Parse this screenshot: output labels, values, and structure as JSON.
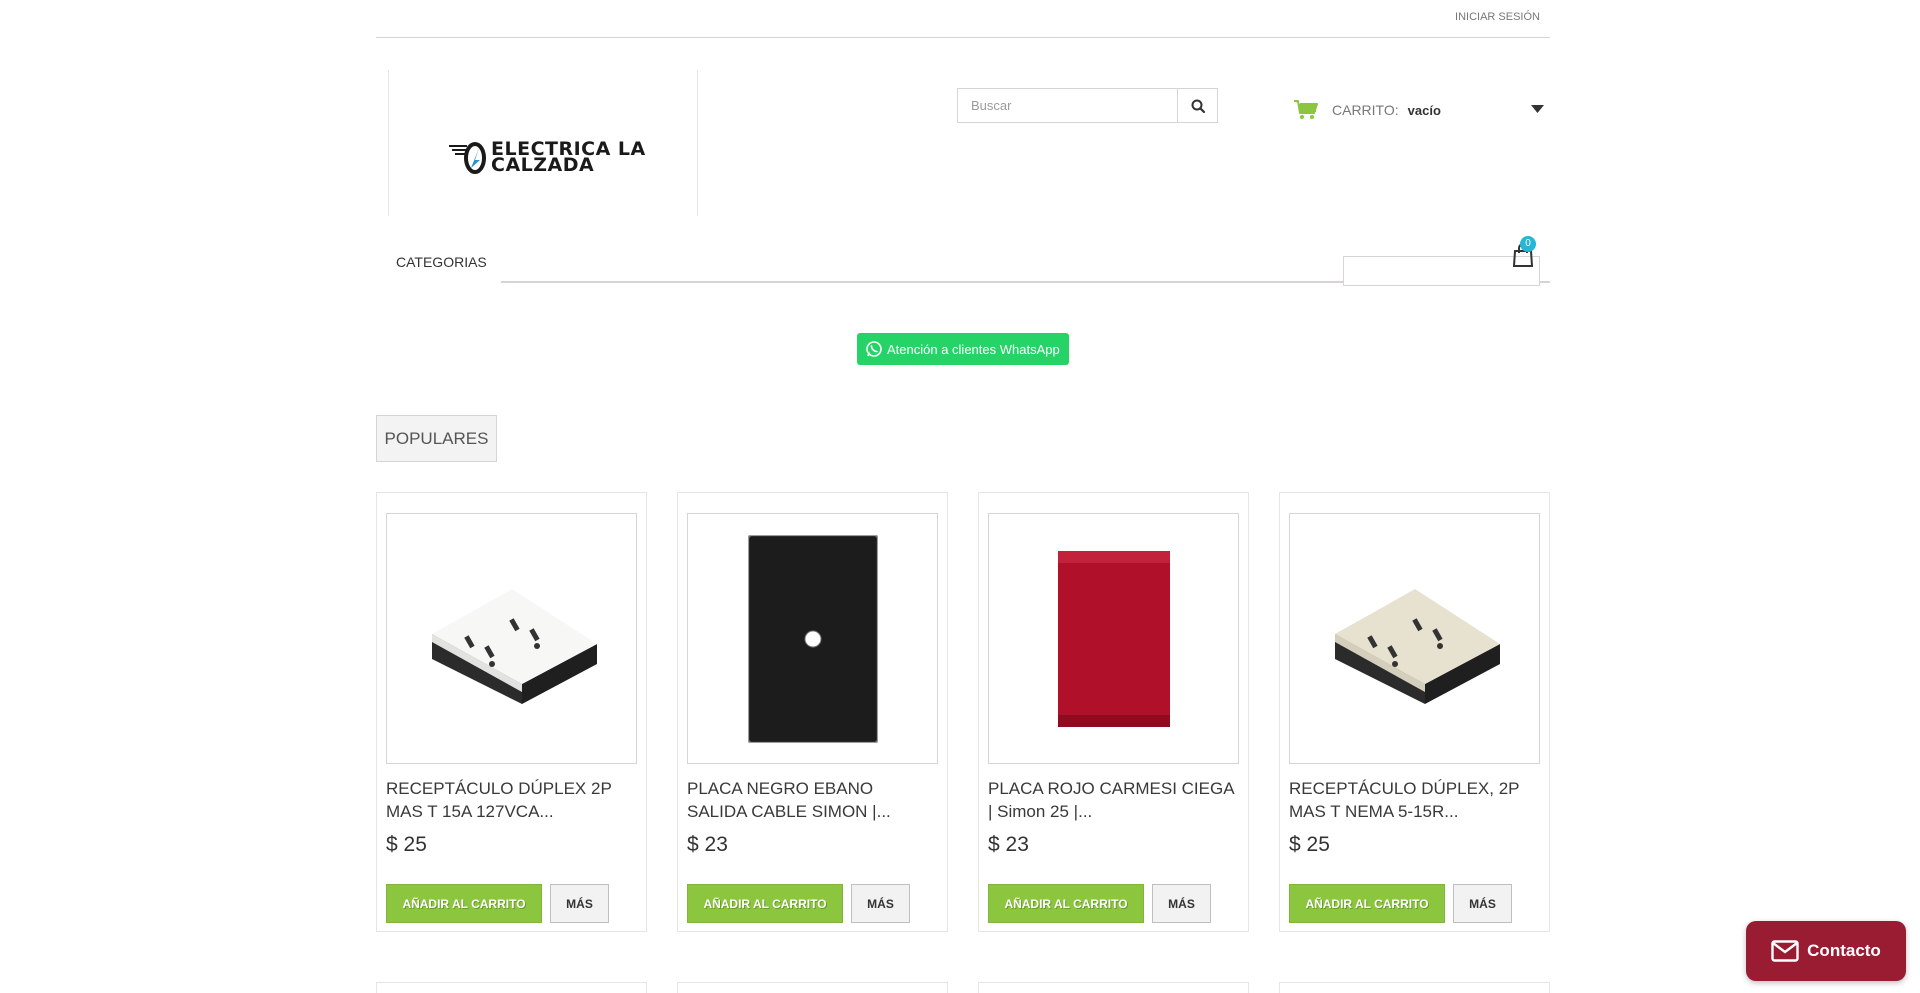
{
  "header": {
    "login_label": "INICIAR SESIÓN",
    "logo_text_line1": "ELECTRICA LA",
    "logo_text_line2": "CALZADA"
  },
  "search": {
    "placeholder": "Buscar",
    "icon": "search-icon"
  },
  "cart": {
    "icon": "shopping-cart-icon",
    "label": "CARRITO:",
    "value": "vacío",
    "badge_count": "0"
  },
  "nav": {
    "categories_label": "CATEGORIAS"
  },
  "whatsapp": {
    "label": "Atención a clientes WhatsApp",
    "color": "#25d366"
  },
  "section": {
    "tab_label": "POPULARES"
  },
  "products": [
    {
      "name": "RECEPTÁCULO DÚPLEX 2P MAS T 15A 127VCA...",
      "price": "$ 25",
      "add_label": "AÑADIR AL CARRITO",
      "more_label": "MÁS",
      "image": "white-duplex-outlet"
    },
    {
      "name": "PLACA NEGRO EBANO SALIDA CABLE SIMON |...",
      "price": "$ 23",
      "add_label": "AÑADIR AL CARRITO",
      "more_label": "MÁS",
      "image": "black-cable-plate"
    },
    {
      "name": "PLACA ROJO CARMESI CIEGA | Simon 25 |...",
      "price": "$ 23",
      "add_label": "AÑADIR AL CARRITO",
      "more_label": "MÁS",
      "image": "red-blank-plate"
    },
    {
      "name": "RECEPTÁCULO DÚPLEX, 2P MAS T NEMA 5-15R...",
      "price": "$ 25",
      "add_label": "AÑADIR AL CARRITO",
      "more_label": "MÁS",
      "image": "ivory-duplex-outlet"
    }
  ],
  "contact": {
    "label": "Contacto",
    "icon": "envelope-icon",
    "color": "#9a1c33"
  },
  "colors": {
    "accent_green": "#8cc63e",
    "badge_blue": "#26b6d6"
  }
}
